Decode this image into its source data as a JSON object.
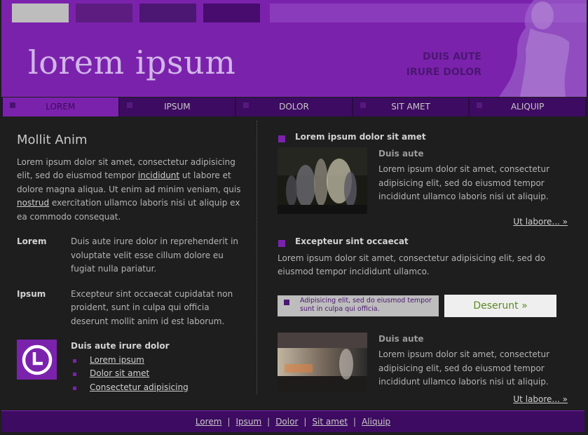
{
  "header": {
    "logo_text": "lorem ipsum",
    "tagline_line1": "DUIS AUTE",
    "tagline_line2": "IRURE DOLOR"
  },
  "nav": [
    {
      "label": "LOREM",
      "active": true
    },
    {
      "label": "IPSUM",
      "active": false
    },
    {
      "label": "DOLOR",
      "active": false
    },
    {
      "label": "SIT AMET",
      "active": false
    },
    {
      "label": "ALIQUIP",
      "active": false
    }
  ],
  "left": {
    "title": "Mollit Anim",
    "intro_part1": "Lorem ipsum dolor sit amet, consectetur adipisicing elit, sed do eiusmod tempor ",
    "intro_link1": "incididunt",
    "intro_part2": " ut labore et dolore magna aliqua. Ut enim ad minim veniam, quis ",
    "intro_link2": "nostrud",
    "intro_part3": " exercitation ullamco laboris nisi ut aliquip ex ea commodo consequat.",
    "definitions": [
      {
        "term": "Lorem",
        "text": "Duis aute irure dolor in reprehenderit in voluptate velit esse cillum dolore eu fugiat nulla pariatur."
      },
      {
        "term": "Ipsum",
        "text": "Excepteur sint occaecat cupidatat non proident, sunt in culpa qui officia deserunt mollit anim id est laborum."
      }
    ],
    "clock_heading": "Duis aute irure dolor",
    "links": [
      "Lorem ipsum",
      "Dolor sit amet",
      "Consectetur adipisicing"
    ]
  },
  "right": {
    "section1_title": "Lorem ipsum dolor sit amet",
    "item1": {
      "heading": "Duis aute",
      "text": "Lorem ipsum dolor sit amet, consectetur adipisicing elit, sed do eiusmod tempor incididunt ullamco laboris nisi ut aliquip.",
      "more": "Ut labore... »"
    },
    "section2_title": "Excepteur sint occaecat",
    "section2_text": "Lorem ipsum dolor sit amet, consectetur adipisicing elit, sed do eiusmod tempor incididunt ullamco.",
    "promo_note": "Adipisicing elit, sed do eiusmod tempor sunt in culpa qui officia.",
    "cta_label": "Deserunt »",
    "item2": {
      "heading": "Duis aute",
      "text": "Lorem ipsum dolor sit amet, consectetur adipisicing elit, sed do eiusmod tempor incididunt ullamco laboris nisi ut aliquip.",
      "more": "Ut labore... »"
    }
  },
  "footer": {
    "links": [
      "Lorem",
      "Ipsum",
      "Dolor",
      "Sit amet",
      "Aliquip"
    ],
    "separator": "|"
  },
  "colors": {
    "header_purple": "#7b22ad",
    "nav_dark": "#3d0b61",
    "background": "#1e1e1e",
    "cta_text": "#5d8a21"
  }
}
